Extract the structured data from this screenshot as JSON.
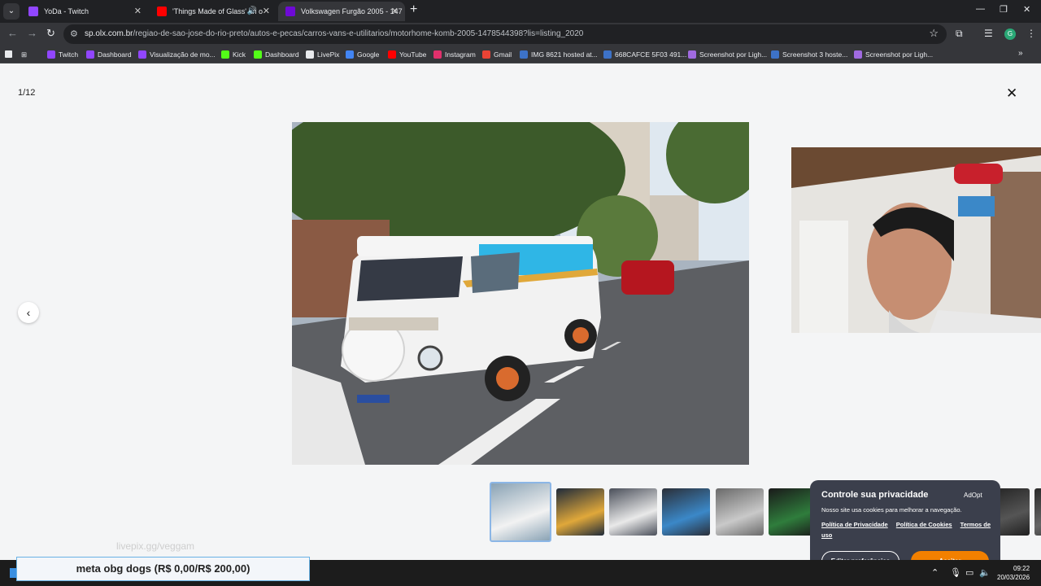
{
  "browser": {
    "tabs": [
      {
        "title": "YoDa - Twitch",
        "favicon_color": "#9146ff",
        "active": false
      },
      {
        "title": "'Things Made of Glass' an o",
        "favicon_color": "#ff0000",
        "active": false
      },
      {
        "title": "Volkswagen Furgão 2005 - 147",
        "favicon_color": "#6e0ad6",
        "active": true
      }
    ],
    "url_host": "sp.olx.com.br",
    "url_path": "/regiao-de-sao-jose-do-rio-preto/autos-e-pecas/carros-vans-e-utilitarios/motorhome-komb-2005-1478544398?lis=listing_2020",
    "profile_initial": "G",
    "bookmarks": [
      {
        "label": "Twitch",
        "color": "#9146ff"
      },
      {
        "label": "Dashboard",
        "color": "#9146ff"
      },
      {
        "label": "Visualização de mo...",
        "color": "#9146ff"
      },
      {
        "label": "Kick",
        "color": "#53fc18"
      },
      {
        "label": "Dashboard",
        "color": "#53fc18"
      },
      {
        "label": "LivePix",
        "color": "#e8eaed"
      },
      {
        "label": "Google",
        "color": "#4285f4"
      },
      {
        "label": "YouTube",
        "color": "#ff0000"
      },
      {
        "label": "Instagram",
        "color": "#e1306c"
      },
      {
        "label": "Gmail",
        "color": "#ea4335"
      },
      {
        "label": "IMG 8621 hosted at...",
        "color": "#3d72c7"
      },
      {
        "label": "668CAFCE 5F03 491...",
        "color": "#3d72c7"
      },
      {
        "label": "Screenshot por Ligh...",
        "color": "#a06ae0"
      },
      {
        "label": "Screenshot 3 hoste...",
        "color": "#3d72c7"
      },
      {
        "label": "Screenshot por Ligh...",
        "color": "#a06ae0"
      }
    ]
  },
  "gallery": {
    "counter": "1/12",
    "thumbnail_count": 11
  },
  "overlay": {
    "watermark": "livepix.gg/veggam",
    "goal": "meta obg dogs (R$ 0,00/R$ 200,00)"
  },
  "cookie": {
    "title": "Controle sua privacidade",
    "brand": "AdOpt",
    "description": "Nosso site usa cookies para melhorar a navegação.",
    "link_privacy": "Política de Privacidade",
    "link_cookies": "Política de Cookies",
    "link_terms": "Termos de uso",
    "btn_preferences": "Editar preferências",
    "btn_accept": "Aceitar",
    "accent": "#f28000"
  },
  "taskbar": {
    "time": "09:22",
    "date": "20/03/2026"
  }
}
